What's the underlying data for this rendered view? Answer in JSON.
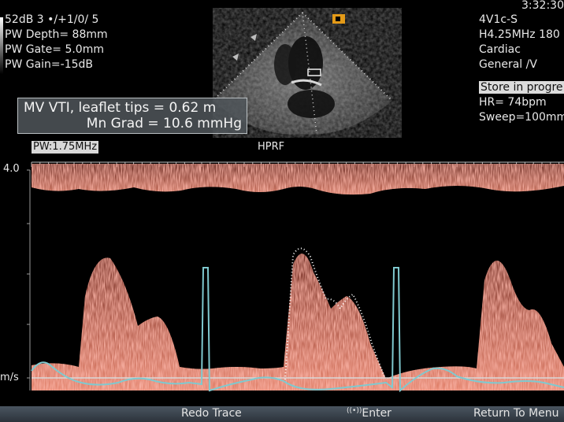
{
  "top_left": {
    "line1": "52dB  3 •/+1/0/ 5",
    "pw_depth": "PW Depth=  88mm",
    "pw_gate": "PW Gate=  5.0mm",
    "pw_gain": "PW Gain=-15dB"
  },
  "clock": "3:32:30",
  "top_right": {
    "probe": "4V1c-S",
    "freq": "H4.25MHz   180",
    "app": "Cardiac",
    "preset": "General /V",
    "store": "Store in progre",
    "hr": "HR=  74bpm",
    "sweep": "Sweep=100mm"
  },
  "measurements": {
    "vti": "MV VTI, leaflet tips = 0.62 m",
    "mn_grad": "Mn Grad = 10.6 mmHg"
  },
  "spectral": {
    "mode_label": "PW:1.75MHz",
    "hprf_label": "HPRF",
    "scale_top": "4.0",
    "scale_unit": "m/s"
  },
  "softkeys": {
    "redo": "Redo Trace",
    "enter_icon": "((•))",
    "enter": "Enter",
    "return": "Return To Menu"
  },
  "colors": {
    "doppler": "#e06a5a",
    "ecg": "#7fc9cf",
    "trace": "#ffffff"
  }
}
